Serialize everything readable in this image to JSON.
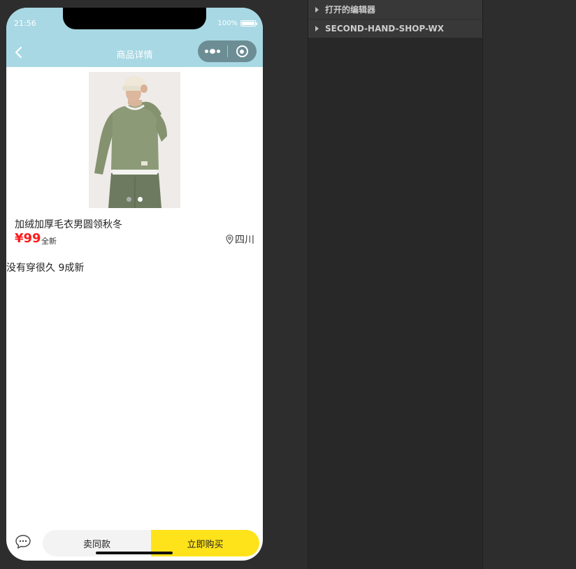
{
  "status_bar": {
    "time": "21:56",
    "battery": "100%"
  },
  "nav": {
    "title": "商品详情"
  },
  "product": {
    "title": "加绒加厚毛衣男圆领秋冬",
    "price": "¥99",
    "condition": "全新",
    "location": "四川",
    "description": "没有穿很久 9成新",
    "image_count": 2,
    "active_image_index": 1
  },
  "actions": {
    "sell_similar": "卖同款",
    "buy_now": "立即购买"
  },
  "explorer": {
    "sections": [
      "打开的编辑器",
      "SECOND-HAND-SHOP-WX"
    ]
  },
  "colors": {
    "navbar": "#a8d8e4",
    "price": "#ff1a1a",
    "buy_button": "#ffe31a",
    "sell_button": "#f3f3f3",
    "ide_background": "#2d2d2d"
  },
  "icons": [
    "back-arrow-icon",
    "more-dots-icon",
    "target-icon",
    "location-pin-icon",
    "chat-bubble-icon",
    "caret-right-icon"
  ]
}
